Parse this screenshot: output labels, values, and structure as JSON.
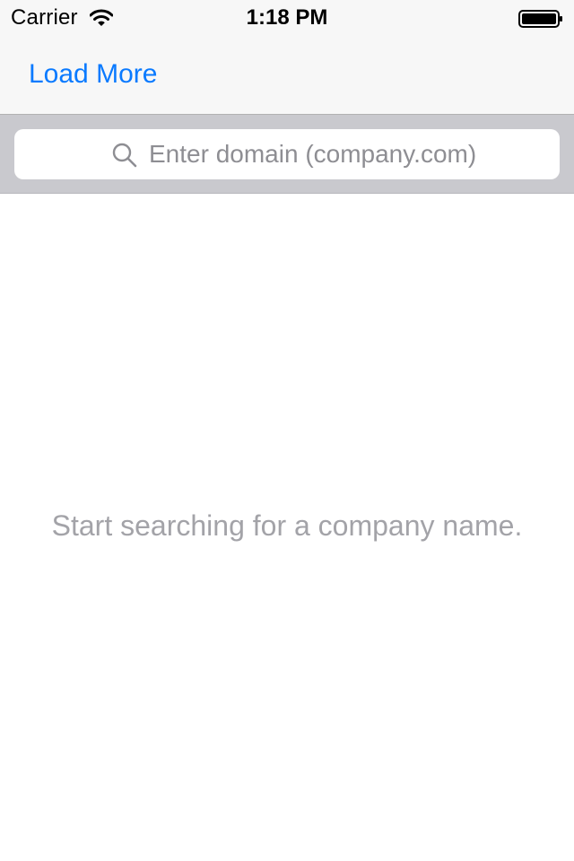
{
  "status_bar": {
    "carrier": "Carrier",
    "time": "1:18 PM",
    "wifi_icon": "wifi-icon",
    "battery_icon": "battery-icon"
  },
  "nav": {
    "left_button": "Load More",
    "accent_color": "#0a7aff"
  },
  "search": {
    "placeholder": "Enter domain (company.com)",
    "value": "",
    "icon": "search-icon"
  },
  "content": {
    "empty_message": "Start searching for a company name."
  }
}
